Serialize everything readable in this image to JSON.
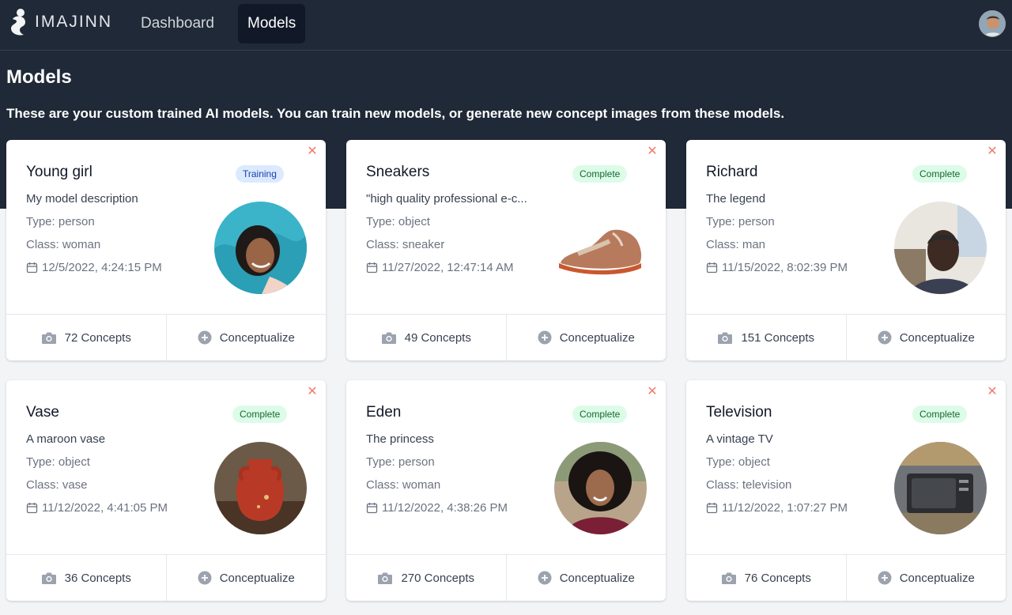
{
  "app": {
    "brand": "IMAJINN",
    "nav": [
      {
        "label": "Dashboard",
        "active": false
      },
      {
        "label": "Models",
        "active": true
      }
    ]
  },
  "page": {
    "title": "Models",
    "subtitle": "These are your custom trained AI models. You can train new models, or generate new concept images from these models."
  },
  "models": [
    {
      "name": "Young girl",
      "status": "Training",
      "description": "My model description",
      "type": "Type: person",
      "class": "Class: woman",
      "date": "12/5/2022, 4:24:15 PM",
      "concepts": "72 Concepts",
      "action": "Conceptualize"
    },
    {
      "name": "Sneakers",
      "status": "Complete",
      "description": "\"high quality professional e-c...",
      "type": "Type: object",
      "class": "Class: sneaker",
      "date": "11/27/2022, 12:47:14 AM",
      "concepts": "49 Concepts",
      "action": "Conceptualize"
    },
    {
      "name": "Richard",
      "status": "Complete",
      "description": "The legend",
      "type": "Type: person",
      "class": "Class: man",
      "date": "11/15/2022, 8:02:39 PM",
      "concepts": "151 Concepts",
      "action": "Conceptualize"
    },
    {
      "name": "Vase",
      "status": "Complete",
      "description": "A maroon vase",
      "type": "Type: object",
      "class": "Class: vase",
      "date": "11/12/2022, 4:41:05 PM",
      "concepts": "36 Concepts",
      "action": "Conceptualize"
    },
    {
      "name": "Eden",
      "status": "Complete",
      "description": "The princess",
      "type": "Type: person",
      "class": "Class: woman",
      "date": "11/12/2022, 4:38:26 PM",
      "concepts": "270 Concepts",
      "action": "Conceptualize"
    },
    {
      "name": "Television",
      "status": "Complete",
      "description": "A vintage TV",
      "type": "Type: object",
      "class": "Class: television",
      "date": "11/12/2022, 1:07:27 PM",
      "concepts": "76 Concepts",
      "action": "Conceptualize"
    }
  ],
  "colors": {
    "header_bg": "#1f2937",
    "page_bg": "#f3f4f6",
    "training_badge": "#dbeafe",
    "complete_badge": "#dcfce7",
    "close_icon": "#ef7d6e"
  },
  "icons": {
    "card_close": "close-icon",
    "date": "calendar-icon",
    "concepts": "camera-icon",
    "conceptualize": "plus-circle-icon"
  }
}
